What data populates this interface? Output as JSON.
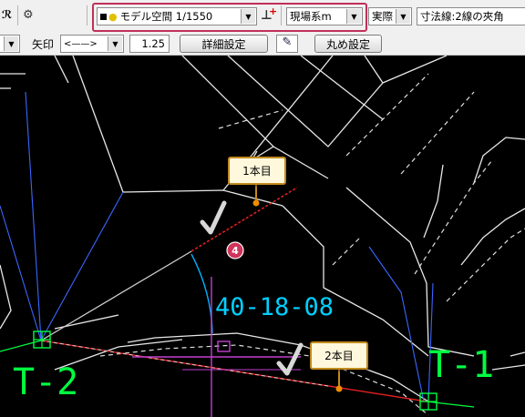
{
  "toolbar1": {
    "layer_text": "モデル空間 1/1550",
    "coord_system": "現場系m",
    "scale_mode": "実際",
    "dimension_type": "寸法線:2線の夾角"
  },
  "toolbar2": {
    "arrow_label": "矢印",
    "arrow_style": "<——>",
    "size_value": "1.25",
    "detail_button": "詳細設定",
    "rounding_button": "丸め設定"
  },
  "drawing": {
    "angle_text": "40-18-08",
    "point_left": "T-2",
    "point_right": "T-1",
    "step_number": "4",
    "callout_first": "1本目",
    "callout_second": "2本目"
  },
  "colors": {
    "highlight": "#c0305a",
    "angle_text": "#00d0ff",
    "point_label": "#00ff40",
    "callout_border": "#c28a1c",
    "marker": "#f08c00"
  }
}
